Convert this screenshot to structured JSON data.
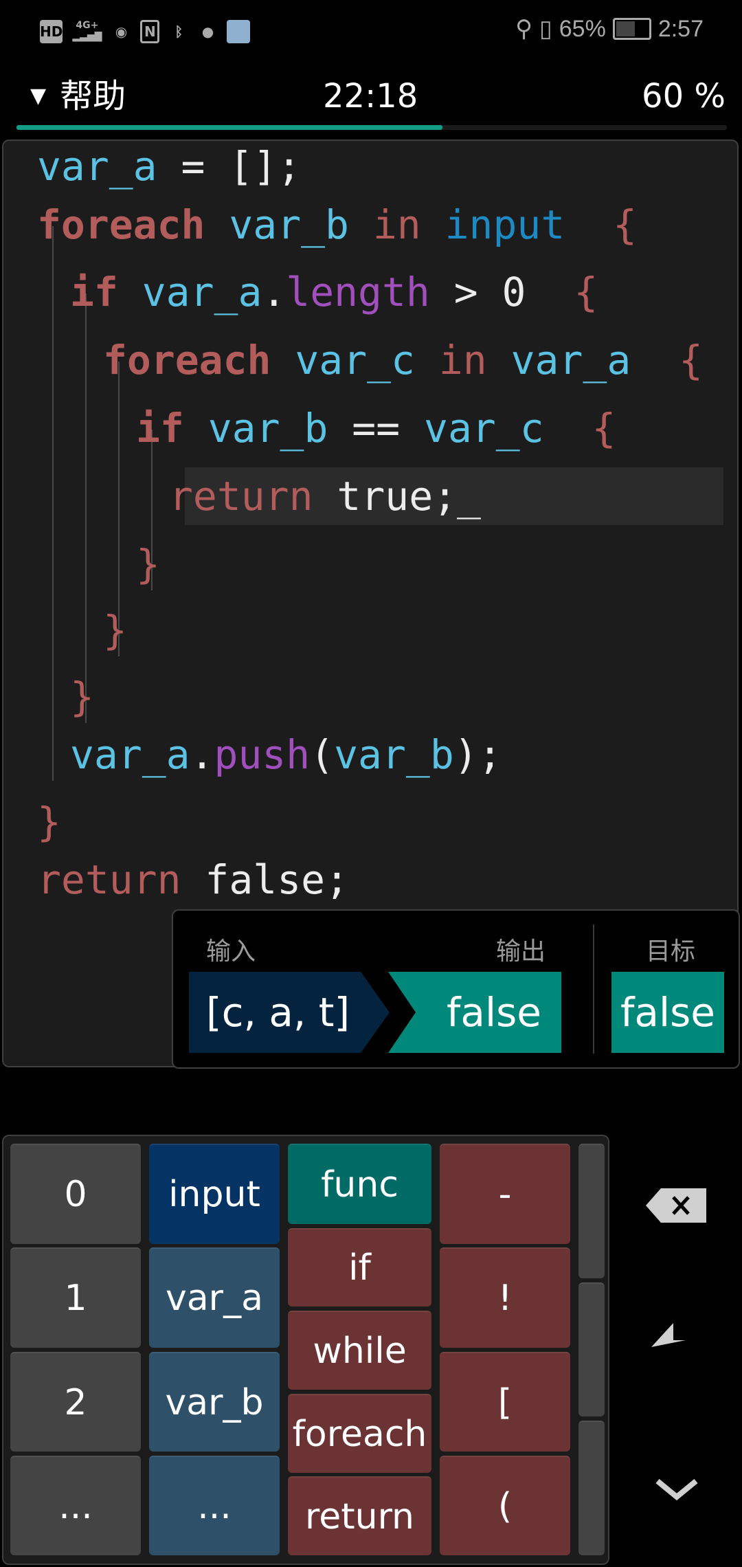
{
  "status_bar": {
    "left_icons": [
      "hd-icon",
      "signal-4g-icon",
      "eye-icon",
      "nfc-icon",
      "bluetooth-icon",
      "wechat-icon",
      "app-icon"
    ],
    "hd_label": "HD",
    "signal_label": "4G+",
    "vibrate_battery_percent": "65%",
    "time": "2:57"
  },
  "header": {
    "menu_label": "帮助",
    "timer": "22:18",
    "progress_label": "60 %",
    "progress": 0.6
  },
  "code": {
    "lines": [
      {
        "indent": 0,
        "tokens": [
          {
            "t": "var_a",
            "c": "var"
          },
          {
            "t": " = [];",
            "c": "plain"
          }
        ]
      },
      {
        "indent": 0,
        "tokens": [
          {
            "t": "foreach",
            "c": "kwb"
          },
          {
            "t": " var_b",
            "c": "var"
          },
          {
            "t": " in",
            "c": "kw"
          },
          {
            "t": " input",
            "c": "in"
          },
          {
            "t": "  {",
            "c": "brace"
          }
        ]
      },
      {
        "indent": 1,
        "tokens": [
          {
            "t": "if",
            "c": "kwb"
          },
          {
            "t": " var_a",
            "c": "var"
          },
          {
            "t": ".",
            "c": "plain"
          },
          {
            "t": "length",
            "c": "prop"
          },
          {
            "t": " > 0  ",
            "c": "plain"
          },
          {
            "t": "{",
            "c": "brace"
          }
        ]
      },
      {
        "indent": 2,
        "tokens": [
          {
            "t": "foreach",
            "c": "kwb"
          },
          {
            "t": " var_c",
            "c": "var"
          },
          {
            "t": " in",
            "c": "kw"
          },
          {
            "t": " var_a",
            "c": "var"
          },
          {
            "t": "  {",
            "c": "brace"
          }
        ]
      },
      {
        "indent": 3,
        "tokens": [
          {
            "t": "if",
            "c": "kwb"
          },
          {
            "t": " var_b",
            "c": "var"
          },
          {
            "t": " == ",
            "c": "plain"
          },
          {
            "t": "var_c",
            "c": "var"
          },
          {
            "t": "  {",
            "c": "brace"
          }
        ]
      },
      {
        "indent": 4,
        "highlight": true,
        "tokens": [
          {
            "t": "return",
            "c": "kw"
          },
          {
            "t": " true;_",
            "c": "plain"
          }
        ]
      },
      {
        "indent": 3,
        "tokens": [
          {
            "t": "}",
            "c": "brace"
          }
        ]
      },
      {
        "indent": 2,
        "tokens": [
          {
            "t": "}",
            "c": "brace"
          }
        ]
      },
      {
        "indent": 1,
        "tokens": [
          {
            "t": "}",
            "c": "brace"
          }
        ]
      },
      {
        "indent": 1,
        "tokens": [
          {
            "t": "var_a",
            "c": "var"
          },
          {
            "t": ".",
            "c": "plain"
          },
          {
            "t": "push",
            "c": "prop"
          },
          {
            "t": "(",
            "c": "plain"
          },
          {
            "t": "var_b",
            "c": "var"
          },
          {
            "t": ");",
            "c": "plain"
          }
        ]
      },
      {
        "indent": 0,
        "tokens": [
          {
            "t": "}",
            "c": "brace"
          }
        ]
      },
      {
        "indent": 0,
        "tokens": [
          {
            "t": "return",
            "c": "kw"
          },
          {
            "t": " false;",
            "c": "plain"
          }
        ]
      }
    ]
  },
  "result": {
    "input_label": "输入",
    "output_label": "输出",
    "target_label": "目标",
    "input_value": "[c, a, t]",
    "output_value": "false",
    "target_value": "false"
  },
  "keypad": {
    "numbers": [
      "0",
      "1",
      "2",
      "..."
    ],
    "variables": [
      "input",
      "var_a",
      "var_b",
      "..."
    ],
    "keywords": [
      "func",
      "if",
      "while",
      "foreach",
      "return"
    ],
    "symbols": [
      "-",
      "!",
      "[",
      "("
    ]
  },
  "side_buttons": [
    "backspace-icon",
    "enter-icon",
    "chevron-down-icon"
  ],
  "colors": {
    "variable": "#5bc2e3",
    "keyword": "#b35c5c",
    "input": "#1d8ac4",
    "property": "#a04fbd",
    "accent": "#139c87",
    "key_red": "#6b3334",
    "key_teal": "#006a65",
    "key_navy": "#053464",
    "key_slate": "#2f5069",
    "key_gray": "#444444"
  }
}
